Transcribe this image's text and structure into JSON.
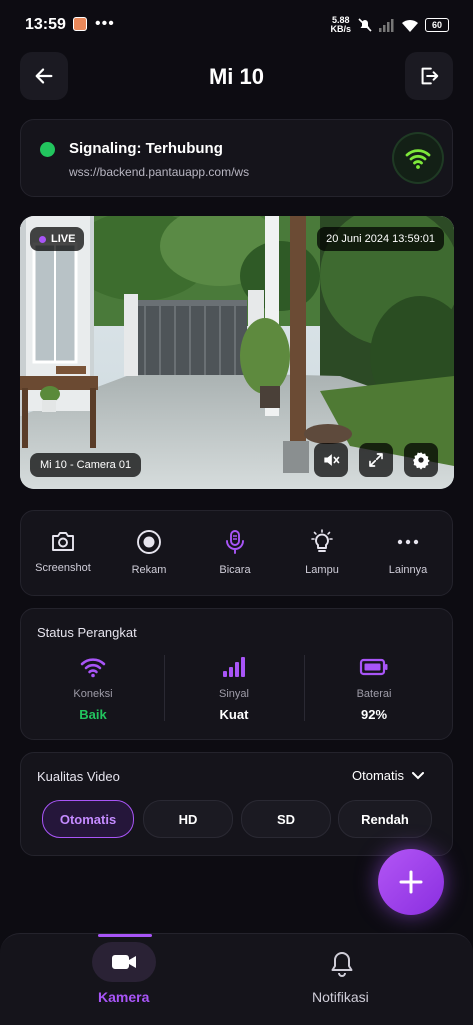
{
  "statusbar": {
    "time": "13:59",
    "net_speed_value": "5.88",
    "net_speed_unit": "KB/s",
    "battery": "60"
  },
  "header": {
    "title": "Mi 10"
  },
  "signaling": {
    "title": "Signaling: Terhubung",
    "url": "wss://backend.pantauapp.com/ws",
    "status_color": "#22c55e"
  },
  "camera": {
    "live_label": "LIVE",
    "timestamp": "20 Juni 2024 13:59:01",
    "camera_name": "Mi 10 - Camera 01"
  },
  "actions": [
    {
      "label": "Screenshot",
      "icon": "camera-icon"
    },
    {
      "label": "Rekam",
      "icon": "record-icon"
    },
    {
      "label": "Bicara",
      "icon": "microphone-icon"
    },
    {
      "label": "Lampu",
      "icon": "lightbulb-icon"
    },
    {
      "label": "Lainnya",
      "icon": "more-icon"
    }
  ],
  "device_status": {
    "title": "Status Perangkat",
    "items": [
      {
        "label": "Koneksi",
        "value": "Baik",
        "icon": "wifi-icon"
      },
      {
        "label": "Sinyal",
        "value": "Kuat",
        "icon": "signal-bars-icon"
      },
      {
        "label": "Baterai",
        "value": "92%",
        "icon": "battery-icon"
      }
    ]
  },
  "video_quality": {
    "title": "Kualitas Video",
    "selected": "Otomatis",
    "options": [
      "Otomatis",
      "HD",
      "SD",
      "Rendah"
    ]
  },
  "bottom_nav": [
    {
      "label": "Kamera",
      "icon": "video-camera-icon",
      "active": true
    },
    {
      "label": "Notifikasi",
      "icon": "bell-icon",
      "active": false
    }
  ],
  "colors": {
    "accent": "#a855f7",
    "good": "#22c55e",
    "background": "#0d0c12"
  }
}
